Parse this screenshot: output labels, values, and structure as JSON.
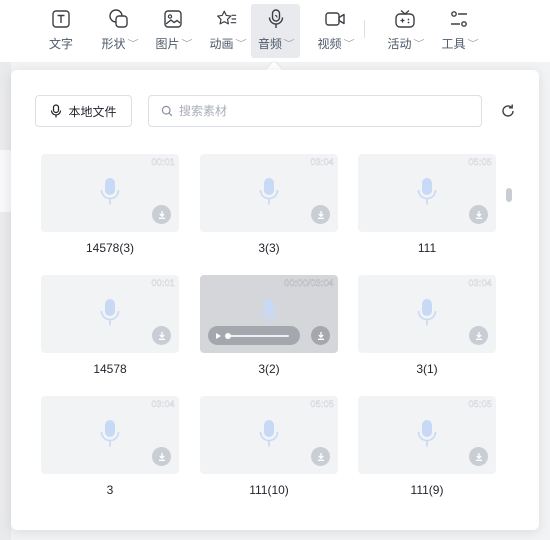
{
  "toolbar": {
    "items": [
      {
        "label": "文字",
        "icon": "text-icon",
        "dropdown": false
      },
      {
        "label": "形状",
        "icon": "shape-icon",
        "dropdown": true
      },
      {
        "label": "图片",
        "icon": "image-icon",
        "dropdown": true
      },
      {
        "label": "动画",
        "icon": "animation-icon",
        "dropdown": true
      },
      {
        "label": "音频",
        "icon": "audio-icon",
        "dropdown": true,
        "active": true
      },
      {
        "label": "视频",
        "icon": "video-icon",
        "dropdown": true
      },
      {
        "label": "活动",
        "icon": "activity-icon",
        "dropdown": true
      },
      {
        "label": "工具",
        "icon": "tools-icon",
        "dropdown": true
      }
    ],
    "dropdown_glyph": "﹀"
  },
  "panel": {
    "local_file_label": "本地文件",
    "search": {
      "placeholder": "搜索素材",
      "value": ""
    }
  },
  "audio_items": [
    {
      "title": "14578(3)",
      "duration": "00:01",
      "playing": false
    },
    {
      "title": "3(3)",
      "duration": "03:04",
      "playing": false
    },
    {
      "title": "111",
      "duration": "05:05",
      "playing": false
    },
    {
      "title": "14578",
      "duration": "00:01",
      "playing": false
    },
    {
      "title": "3(2)",
      "duration": "00:00/03:04",
      "playing": true,
      "progress": 0.0
    },
    {
      "title": "3(1)",
      "duration": "03:04",
      "playing": false
    },
    {
      "title": "3",
      "duration": "03:04",
      "playing": false
    },
    {
      "title": "111(10)",
      "duration": "05:05",
      "playing": false
    },
    {
      "title": "111(9)",
      "duration": "05:05",
      "playing": false
    }
  ],
  "colors": {
    "mic_icon": "#c8d9f5",
    "accent_bg": "#e8eaed"
  }
}
